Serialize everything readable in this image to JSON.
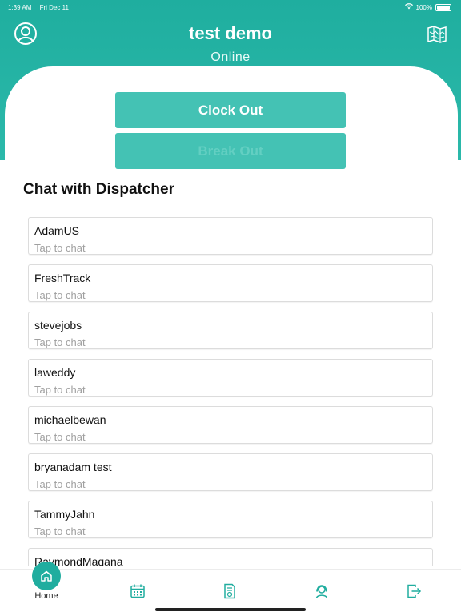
{
  "status": {
    "time": "1:39 AM",
    "date": "Fri Dec 11",
    "battery": "100%"
  },
  "header": {
    "title": "test demo",
    "subtitle": "Online",
    "profile_icon": "person-circle-icon",
    "map_icon": "map-icon"
  },
  "actions": {
    "clock_out_label": "Clock Out",
    "second_button_label": "Break Out"
  },
  "chat": {
    "section_title": "Chat with Dispatcher",
    "items": [
      {
        "name": "AdamUS",
        "hint": "Tap to chat"
      },
      {
        "name": "FreshTrack",
        "hint": "Tap to chat"
      },
      {
        "name": "stevejobs",
        "hint": "Tap to chat"
      },
      {
        "name": "laweddy",
        "hint": "Tap to chat"
      },
      {
        "name": "michaelbewan",
        "hint": "Tap to chat"
      },
      {
        "name": "bryanadam test",
        "hint": "Tap to chat"
      },
      {
        "name": "TammyJahn",
        "hint": "Tap to chat"
      },
      {
        "name": "RaymondMagana",
        "hint": ""
      }
    ]
  },
  "nav": {
    "home_label": "Home",
    "icons": [
      "home-icon",
      "calendar-icon",
      "document-icon",
      "support-agent-icon",
      "logout-icon"
    ]
  },
  "colors": {
    "brand": "#20ad9f",
    "button": "#44c2b4"
  }
}
